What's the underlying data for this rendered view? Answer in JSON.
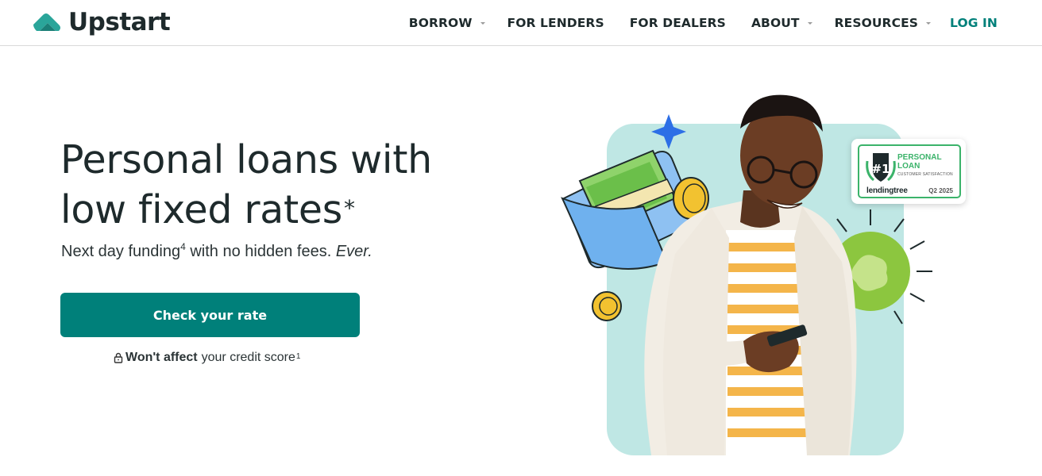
{
  "brand": {
    "name": "Upstart",
    "color": "#1e2a2c",
    "accent": "#00807a",
    "logo_color": "#2aa59a"
  },
  "nav": {
    "items": [
      {
        "label": "BORROW",
        "has_dropdown": true
      },
      {
        "label": "FOR LENDERS",
        "has_dropdown": false
      },
      {
        "label": "FOR DEALERS",
        "has_dropdown": false
      },
      {
        "label": "ABOUT",
        "has_dropdown": true
      },
      {
        "label": "RESOURCES",
        "has_dropdown": true
      }
    ],
    "login_label": "LOG IN"
  },
  "hero": {
    "title_line1": "Personal loans with",
    "title_line2": "low fixed rates",
    "title_mark": "*",
    "sub_part1": "Next day funding",
    "sub_sup": "4",
    "sub_part2": " with no hidden fees. ",
    "sub_emph": "Ever.",
    "cta_label": "Check your rate",
    "note_bold": "Won't affect",
    "note_text": "your credit score",
    "note_sup": "1"
  },
  "badge": {
    "rank": "#1",
    "title": "PERSONAL LOAN",
    "subtitle": "CUSTOMER SATISFACTION",
    "brand": "lendingtree",
    "date": "Q2 2025"
  },
  "icons": {
    "logo": "upstart-logo-icon",
    "caret": "chevron-down-icon",
    "lock": "lock-icon"
  }
}
